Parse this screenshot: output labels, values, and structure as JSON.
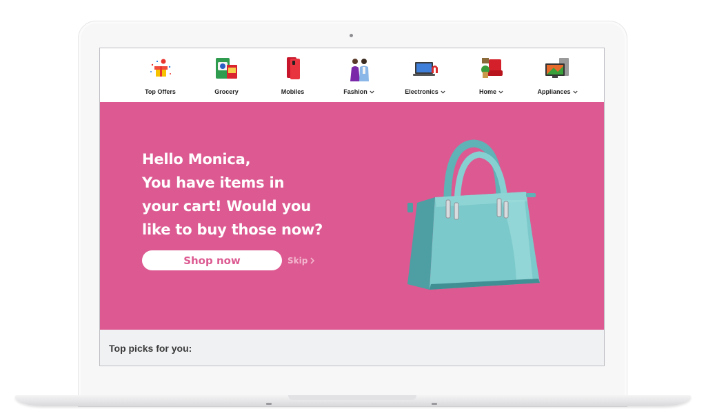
{
  "nav": {
    "categories": [
      {
        "label": "Top Offers",
        "icon": "gift-offers-icon",
        "has_dropdown": false
      },
      {
        "label": "Grocery",
        "icon": "grocery-icon",
        "has_dropdown": false
      },
      {
        "label": "Mobiles",
        "icon": "mobile-phone-icon",
        "has_dropdown": false
      },
      {
        "label": "Fashion",
        "icon": "fashion-icon",
        "has_dropdown": true
      },
      {
        "label": "Electronics",
        "icon": "laptop-icon",
        "has_dropdown": true
      },
      {
        "label": "Home",
        "icon": "home-furniture-icon",
        "has_dropdown": true
      },
      {
        "label": "Appliances",
        "icon": "tv-appliance-icon",
        "has_dropdown": true
      }
    ]
  },
  "hero": {
    "greeting_lines": [
      "Hello Monica,",
      "You have items in",
      "your cart! Would you",
      "like to buy those now?"
    ],
    "shop_label": "Shop now",
    "skip_label": "Skip",
    "image": "teal-handbag-image"
  },
  "picks": {
    "title": "Top picks for you:"
  },
  "colors": {
    "banner": "#dc5a91",
    "bag": "#79c6c8",
    "strip": "#f0f1f3"
  }
}
